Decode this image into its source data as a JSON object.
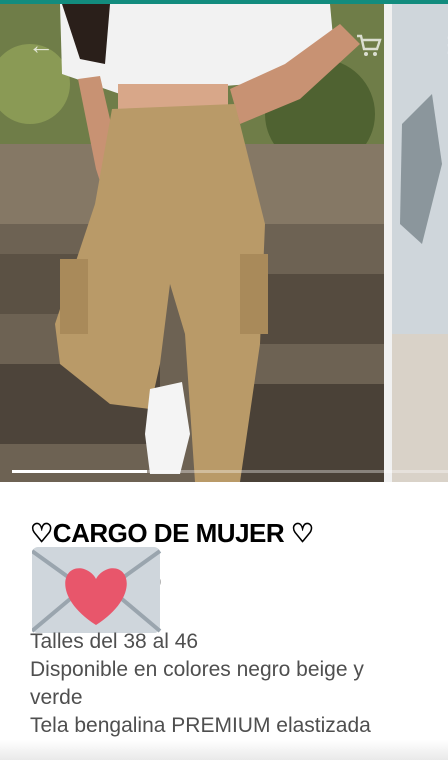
{
  "header": {
    "back_icon": "arrow-left-icon",
    "cart_icon": "cart-icon",
    "menu_icon": "more-vert-icon"
  },
  "carousel": {
    "current": 1,
    "progress_fraction": 0.31
  },
  "product": {
    "title": "♡CARGO DE MUJER ♡",
    "price_visible": "0",
    "sticker": "envelope-heart-emoji",
    "description": [
      "Talles del 38 al 46",
      "Disponible en colores negro beige y",
      "verde",
      "Tela bengalina PREMIUM elastizada"
    ]
  },
  "colors": {
    "accent": "#128c7e",
    "heart": "#e8566b",
    "envelope": "#cfd6dc"
  }
}
